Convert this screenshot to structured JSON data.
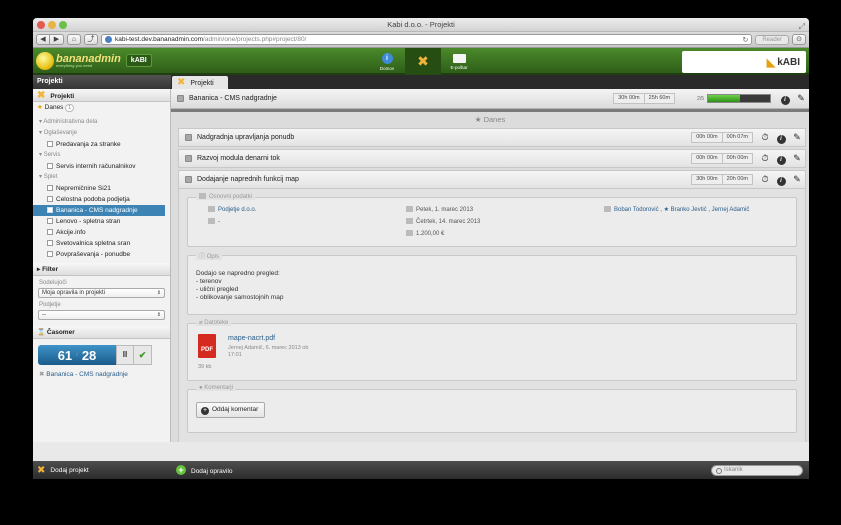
{
  "window": {
    "title": "Kabi d.o.o. - Projekti"
  },
  "toolbar": {
    "back": "◀",
    "forward": "▶",
    "home": "⌂",
    "share": "⤴",
    "url_host": "kabi-test.dev.bananadmin.com",
    "url_path": "/admin/one/projects.php#project/80/",
    "reader": "Reader"
  },
  "app": {
    "logo_text": "bananadmin",
    "logo_sub": "everything you need",
    "kabi_mini": "kABI",
    "nav": [
      {
        "label": "Domov",
        "icon": "info-icon"
      },
      {
        "label": "",
        "icon": "tools-icon"
      },
      {
        "label": "E-poštar",
        "icon": "mail-icon"
      }
    ],
    "brand": "kABI"
  },
  "tabs": {
    "sidebar_title": "Projekti",
    "active_tab": "Projekti"
  },
  "sidebar": {
    "projects_section": "Projekti",
    "danes": "Danes",
    "danes_badge": "1",
    "groups": [
      {
        "title": "Administrativna dela",
        "items": []
      },
      {
        "title": "Oglaševanje",
        "items": [
          "Predavanja za stranke"
        ]
      },
      {
        "title": "Servis",
        "items": [
          "Servis internih računalnikov"
        ]
      },
      {
        "title": "Splet",
        "items": [
          "Nepremičnine Si21",
          "Celostna podoba podjetja",
          "Bananica - CMS nadgradnje",
          "Lenovo - spletna stran",
          "Akcije.info",
          "Svetovalnica spletna sran",
          "Povpraševanja - ponudbe"
        ]
      }
    ],
    "selected_item": "Bananica - CMS nadgradnje",
    "filter_section": "Filter",
    "filter_participants_label": "Sodelujoči",
    "filter_participants_value": "Moja opravila in projekti",
    "filter_company_label": "Podjetje",
    "filter_company_value": "--",
    "timer_section": "Časomer",
    "timer_minutes": "61",
    "timer_seconds": "28",
    "timer_pause": "II",
    "timer_ok": "✔",
    "timer_task": "Bananica - CMS nadgradnje"
  },
  "project": {
    "title": "Bananica - CMS nadgradnje",
    "time_spent": "30h 00m",
    "time_planned": "25h 60m",
    "progress_label": "2/5",
    "progress": 0.52
  },
  "today_label": "Danes",
  "tasks": [
    {
      "title": "Nadgradnja upravljanja ponudb",
      "spent": "00h 00m",
      "planned": "00h 07m"
    },
    {
      "title": "Razvoj modula denarni tok",
      "spent": "00h 00m",
      "planned": "00h 00m"
    },
    {
      "title": "Dodajanje naprednih funkcij map",
      "spent": "30h 00m",
      "planned": "20h 00m"
    }
  ],
  "detail": {
    "basic_title": "Osnovni podatki",
    "company": "Podjetje d.o.o.",
    "contact": "-",
    "start_date": "Petek, 1. marec 2013",
    "end_date": "Četrtek, 14. marec 2013",
    "amount": "1.200,00 €",
    "people": "Boban Todorović , ★ Branko Jevtić , Jernej Adamič",
    "desc_title": "Opis",
    "description": "Dodajo se napredno pregled:\n- terenov\n- ulični pregled\n- oblikovanje samostojnih map",
    "files_title": "Datoteke",
    "file_name": "mape-nacrt.pdf",
    "file_meta": "Jernej Adamič, 6. marec 2013 ob 17:01",
    "file_size": "39 kb",
    "file_type": "PDF",
    "comments_title": "Komentarji",
    "add_comment": "Oddaj komentar"
  },
  "bottombar": {
    "add_project": "Dodaj projekt",
    "add_task": "Dodaj opravilo",
    "search_placeholder": "Iskanik"
  }
}
